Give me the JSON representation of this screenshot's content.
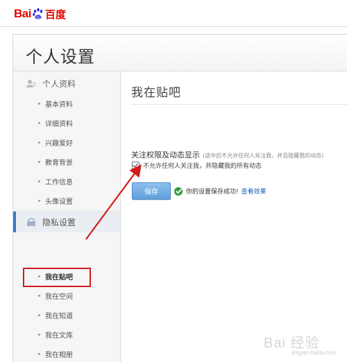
{
  "logo": {
    "text_bai": "Bai",
    "text_du": "百度"
  },
  "header": {
    "title": "个人设置"
  },
  "sidebar": {
    "groups": [
      {
        "label": "个人资料",
        "items": [
          "基本资料",
          "详细资料",
          "兴趣爱好",
          "教育背景",
          "工作信息",
          "头像设置"
        ]
      },
      {
        "label": "隐私设置",
        "items": [
          "我在贴吧",
          "我在空间",
          "我在知道",
          "我在文库",
          "我在相册"
        ]
      }
    ]
  },
  "content": {
    "title": "我在贴吧",
    "section_label": "关注权限及动态显示",
    "section_hint": "(选中后不允许任何人关注我，并且隐藏我的动态)",
    "checkbox_label": "不允许任何人关注我，并隐藏我的所有动态",
    "checkbox_checked": true,
    "save_label": "保存",
    "success_message": "你的设置保存成功!",
    "view_link": "查看效果"
  },
  "watermark": {
    "main": "Bai 经验",
    "sub": "jingyan.baidu.com"
  },
  "colors": {
    "brand_red": "#e10601",
    "accent_blue": "#3c79c6",
    "annotation_red": "#d21b1b",
    "success_green": "#2e9b39",
    "link_blue": "#1a62b8"
  }
}
